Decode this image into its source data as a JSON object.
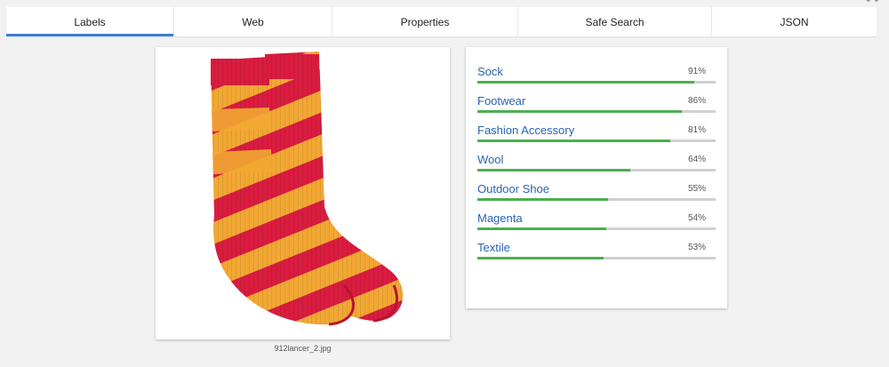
{
  "tabs": [
    {
      "label": "Labels",
      "active": true
    },
    {
      "label": "Web",
      "active": false
    },
    {
      "label": "Properties",
      "active": false
    },
    {
      "label": "Safe Search",
      "active": false
    },
    {
      "label": "JSON",
      "active": false
    }
  ],
  "image": {
    "filename": "912lancer_2.jpg",
    "subject": "pair of red and yellow striped wool socks"
  },
  "labels": [
    {
      "name": "Sock",
      "score": 0.91,
      "percent": "91%"
    },
    {
      "name": "Footwear",
      "score": 0.86,
      "percent": "86%"
    },
    {
      "name": "Fashion Accessory",
      "score": 0.81,
      "percent": "81%"
    },
    {
      "name": "Wool",
      "score": 0.64,
      "percent": "64%"
    },
    {
      "name": "Outdoor Shoe",
      "score": 0.55,
      "percent": "55%"
    },
    {
      "name": "Magenta",
      "score": 0.54,
      "percent": "54%"
    },
    {
      "name": "Textile",
      "score": 0.53,
      "percent": "53%"
    }
  ],
  "colors": {
    "accent": "#3d7dd6",
    "bar_fill": "#4caf50",
    "bar_track": "#d0d0d0",
    "label_text": "#2a64b3",
    "sock_red": "#d91c3f",
    "sock_yellow": "#f2a833"
  },
  "icons": {
    "corner": "expand-icon"
  }
}
